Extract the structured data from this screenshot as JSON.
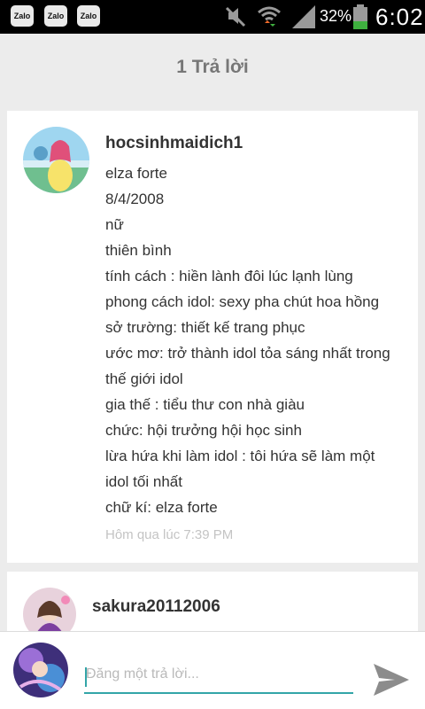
{
  "status_bar": {
    "notification_app_label": "Zalo",
    "battery_percent": "32%",
    "time": "6:02",
    "icons": [
      "mute-icon",
      "wifi-icon",
      "signal-icon",
      "battery-icon"
    ]
  },
  "header": {
    "title": "1 Trả lời"
  },
  "comments": [
    {
      "username": "hocsinhmaidich1",
      "lines": [
        "elza forte",
        "8/4/2008",
        "nữ",
        "thiên bình",
        "tính cách : hiền lành đôi lúc lạnh lùng",
        "phong cách idol: sexy pha chút hoa hồng",
        "sở trường: thiết kế trang phục",
        "ước mơ: trở thành idol tỏa sáng nhất trong",
        "thế giới idol",
        "gia thế : tiểu thư con nhà giàu",
        "chức: hội trưởng hội học sinh",
        "lừa hứa khi làm idol : tôi hứa sẽ làm một",
        "idol tối nhất",
        "chữ kí: elza forte"
      ],
      "timestamp": "Hôm qua lúc 7:39 PM"
    },
    {
      "username": "sakura20112006"
    }
  ],
  "reply": {
    "placeholder": "Đăng một trả lời..."
  },
  "colors": {
    "accent": "#33a5a8",
    "background": "#ececec",
    "send_icon": "#8c8c8c"
  }
}
